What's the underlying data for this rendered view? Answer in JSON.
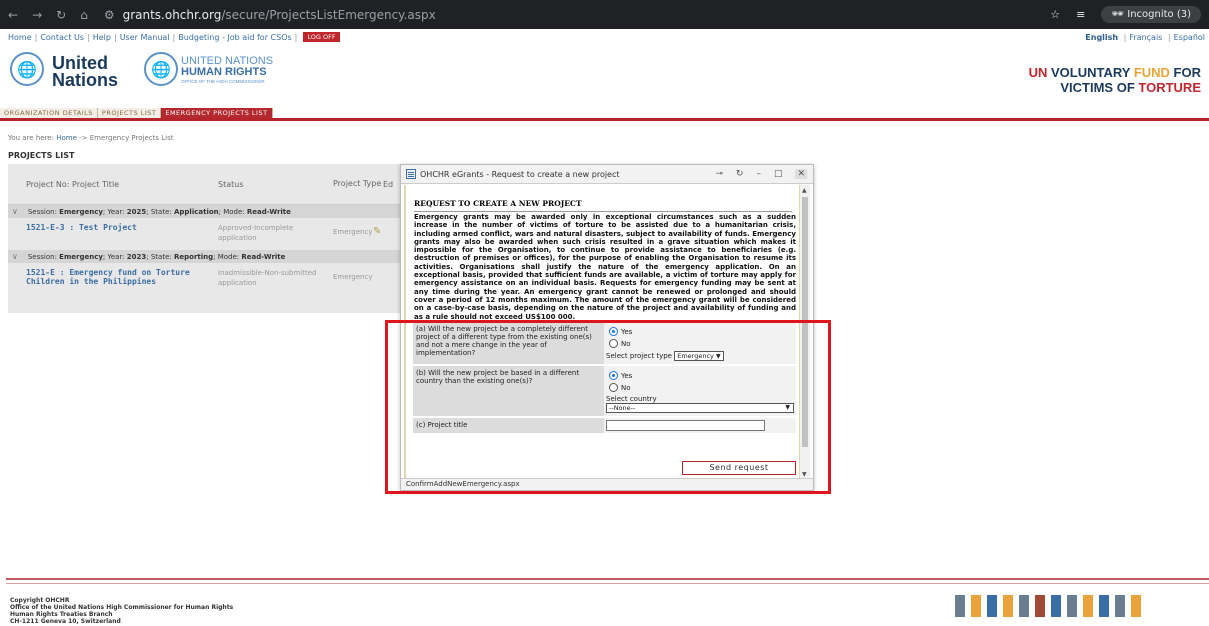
{
  "browser": {
    "url_domain": "grants.ohchr.org",
    "url_path": "/secure/ProjectsListEmergency.aspx",
    "incognito_label": "Incognito (3)"
  },
  "toplinks": {
    "items": [
      "Home",
      "Contact Us",
      "Help",
      "User Manual",
      "Budgeting - Job aid for CSOs"
    ],
    "logoff": "LOG OFF",
    "lang_english": "English",
    "lang_other": [
      "Français",
      "Español"
    ]
  },
  "header": {
    "un_line1": "United",
    "un_line2": "Nations",
    "hr_line1": "UNITED NATIONS",
    "hr_line2": "HUMAN RIGHTS",
    "hr_line3": "OFFICE OF THE HIGH COMMISSIONER",
    "vf_un": "UN",
    "vf_voluntary": "VOLUNTARY",
    "vf_fund": "FUND",
    "vf_for": "FOR",
    "vf_victims_of": "VICTIMS OF",
    "vf_torture": "TORTURE"
  },
  "tabs": [
    "ORGANIZATION DETAILS",
    "PROJECTS LIST",
    "EMERGENCY PROJECTS LIST"
  ],
  "breadcrumb": {
    "prefix": "You are here:",
    "home": "Home",
    "current": "-> Emergency Projects List"
  },
  "page_title": "PROJECTS LIST",
  "projects_table": {
    "headers": {
      "no_title": "Project No: Project Title",
      "status": "Status",
      "type": "Project Type",
      "edit": "Ed"
    },
    "sessions": [
      {
        "session_label": "Session:",
        "session_value": "Emergency",
        "year_label": "; Year:",
        "year_value": "2025",
        "state_label": "; State:",
        "state_value": "Application",
        "mode_label": "; Mode:",
        "mode_value": "Read-Write",
        "project_title": "1521-E-3 : Test Project",
        "project_status": "Approved-Incomplete application",
        "project_type": "Emergency"
      },
      {
        "session_label": "Session:",
        "session_value": "Emergency",
        "year_label": "; Year:",
        "year_value": "2023",
        "state_label": "; State:",
        "state_value": "Reporting",
        "mode_label": "; Mode:",
        "mode_value": "Read-Write",
        "project_title": "1521-E : Emergency fund on Torture Children in the Philippines",
        "project_status": "Inadmissible-Non-submitted application",
        "project_type": "Emergency"
      }
    ]
  },
  "modal": {
    "title": "OHCHR eGrants - Request to create a new project",
    "request_title": "REQUEST TO CREATE A NEW PROJECT",
    "request_text": "Emergency grants may be awarded only in exceptional circumstances such as a sudden increase in the number of victims of torture to be assisted due to a humanitarian crisis, including armed conflict, wars and natural disasters, subject to availability of funds. Emergency grants may also be awarded when such crisis resulted in a grave situation which makes it impossible for the Organisation, to continue to provide assistance to beneficiaries (e.g. destruction of premises or offices), for the purpose of enabling the Organisation to resume its activities. Organisations shall justify the nature of the emergency application. On an exceptional basis, provided that sufficient funds are available, a victim of torture may apply for emergency assistance on an individual basis. Requests for emergency funding may be sent at any time during the year. An emergency grant cannot be renewed or prolonged and should cover a period of 12 months maximum. The amount of the emergency grant will be considered on a case-by-case basis, depending on the nature of the project and availability of funding and as a rule should not exceed US$100 000.",
    "q_a": "(a) Will the new project be a completely different project of a different type from the existing one(s) and not a mere change in the year of implementation?",
    "q_b": "(b) Will the new project be based in a different country than the existing one(s)?",
    "q_c": "(c) Project title",
    "yes": "Yes",
    "no": "No",
    "select_type_label": "Select project type",
    "select_type_value": "Emergency",
    "select_country_label": "Select country",
    "select_country_value": "--None--",
    "project_title_value": "",
    "send_button": "Send request",
    "status_bar": "ConfirmAddNewEmergency.aspx"
  },
  "footer": {
    "line1": "Copyright OHCHR",
    "line2": "Office of the United Nations High Commissioner for Human Rights",
    "line3": "Human Rights Treaties Branch",
    "line4": "CH-1211 Geneva 10, Switzerland"
  },
  "colors": {
    "brand_red": "#b5232b",
    "link_blue": "#3a6ea5",
    "highlight": "#e0151b",
    "accent_orange": "#e8a33a"
  }
}
